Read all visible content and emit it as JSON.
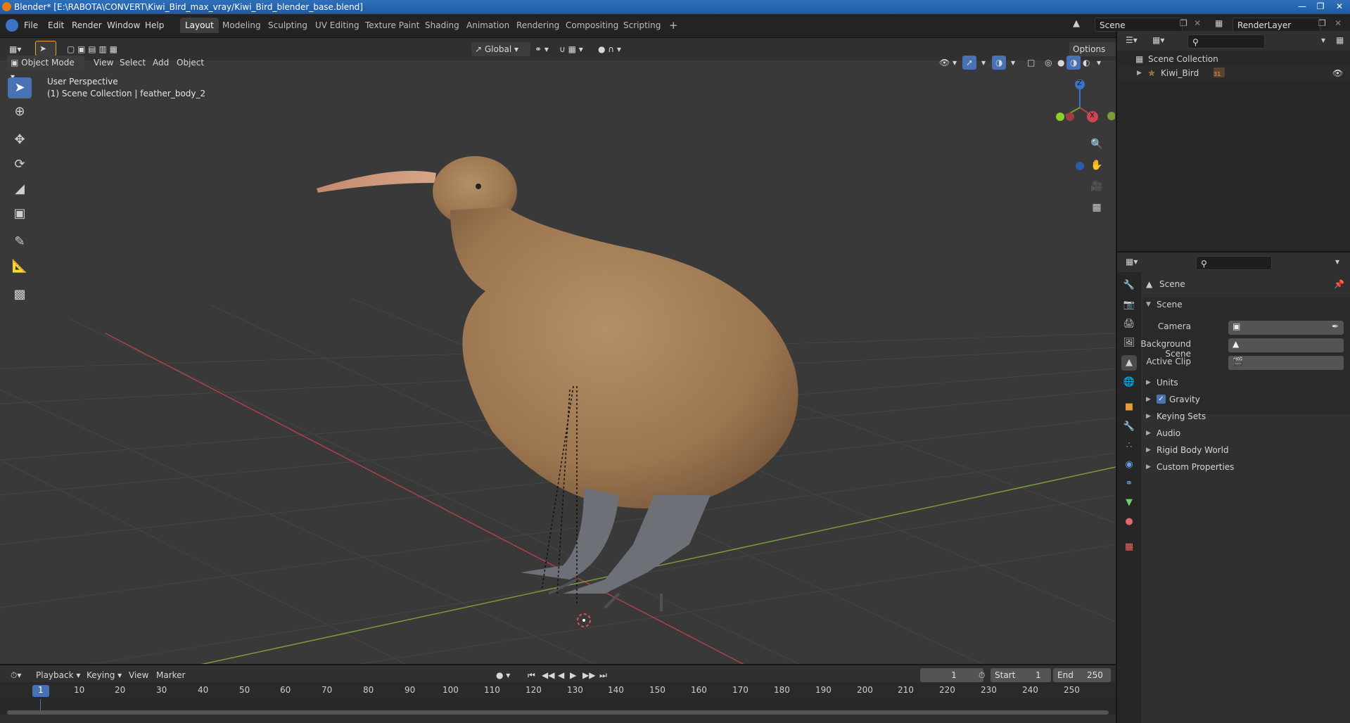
{
  "titlebar": {
    "title": "Blender* [E:\\RABOTA\\CONVERT\\Kiwi_Bird_max_vray/Kiwi_Bird_blender_base.blend]"
  },
  "menu": {
    "file": "File",
    "edit": "Edit",
    "render": "Render",
    "window": "Window",
    "help": "Help"
  },
  "workspaces": [
    "Layout",
    "Modeling",
    "Sculpting",
    "UV Editing",
    "Texture Paint",
    "Shading",
    "Animation",
    "Rendering",
    "Compositing",
    "Scripting"
  ],
  "scene_field": "Scene",
  "renderlayer_field": "RenderLayer",
  "viewport": {
    "orientation": "Global",
    "options": "Options",
    "mode": "Object Mode",
    "view": "View",
    "select": "Select",
    "add": "Add",
    "object": "Object",
    "overlay_title": "User Perspective",
    "overlay_sub": "(1) Scene Collection | feather_body_2",
    "gizmo": {
      "z": "Z",
      "x": "X"
    }
  },
  "outliner": {
    "root": "Scene Collection",
    "child": "Kiwi_Bird",
    "child_badge": "31"
  },
  "properties": {
    "header": "Scene",
    "panel": "Scene",
    "camera": "Camera",
    "background_scene": "Background Scene",
    "active_clip": "Active Clip",
    "sections": [
      "Units",
      "Gravity",
      "Keying Sets",
      "Audio",
      "Rigid Body World",
      "Custom Properties"
    ],
    "gravity_checked": true
  },
  "timeline": {
    "playback": "Playback",
    "keying": "Keying",
    "view": "View",
    "marker": "Marker",
    "current_frame": "1",
    "start_label": "Start",
    "start_value": "1",
    "end_label": "End",
    "end_value": "250",
    "ticks": [
      "1",
      "10",
      "20",
      "30",
      "40",
      "50",
      "60",
      "70",
      "80",
      "90",
      "100",
      "110",
      "120",
      "130",
      "140",
      "150",
      "160",
      "170",
      "180",
      "190",
      "200",
      "210",
      "220",
      "230",
      "240",
      "250"
    ]
  },
  "colors": {
    "accent": "#4772b3",
    "x_axis": "#b3414a",
    "y_axis": "#7a9b3a",
    "z_axis": "#3d72c9"
  }
}
